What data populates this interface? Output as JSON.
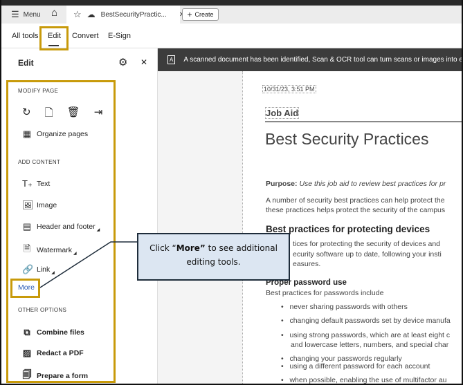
{
  "tabbar": {
    "menu": "Menu",
    "doc_tab": "BestSecurityPractic...",
    "create": "Create"
  },
  "toolbar": {
    "tabs": [
      "All tools",
      "Edit",
      "Convert",
      "E-Sign"
    ]
  },
  "panel": {
    "title": "Edit",
    "modify_page": {
      "heading": "MODIFY PAGE",
      "organize": "Organize pages"
    },
    "add_content": {
      "heading": "ADD CONTENT",
      "items": [
        "Text",
        "Image",
        "Header and footer",
        "Watermark",
        "Link"
      ],
      "more": "More"
    },
    "other_options": {
      "heading": "OTHER OPTIONS",
      "items": [
        "Combine files",
        "Redact a PDF",
        "Prepare a form"
      ]
    }
  },
  "banner": {
    "text": "A scanned document has been identified, Scan & OCR tool can turn scans or images into editable"
  },
  "document": {
    "timestamp": "10/31/23, 3:51 PM",
    "label": "Job Aid",
    "title": "Best Security Practices",
    "purpose_label": "Purpose:",
    "purpose_text": "Use this job aid to review best practices for pr",
    "intro": [
      "A number of security best practices can help protect the",
      "these practices helps protect the security of the campus"
    ],
    "h2": "Best practices for protecting devices",
    "devices": [
      "tices for protecting the security of devices and",
      "ecurity software up to date, following your insti",
      "easures."
    ],
    "h3": "Proper password use",
    "pw_intro": "Best practices for passwords include",
    "bullets": [
      "never sharing passwords with others",
      "changing default passwords set by device manufa",
      "using strong passwords, which are at least eight c",
      "and lowercase letters, numbers, and special char",
      "changing your passwords regularly",
      "using a different password for each account",
      "when possible, enabling the use of multifactor au"
    ]
  },
  "callout": {
    "pre": "Click “",
    "bold": "More”",
    "post": " to see additional",
    "line2": "editing  tools."
  },
  "colors": {
    "highlight": "#c89a0a",
    "callout_bg": "#dce6f2",
    "banner": "#3c3c3c",
    "link": "#2a5bb5"
  }
}
